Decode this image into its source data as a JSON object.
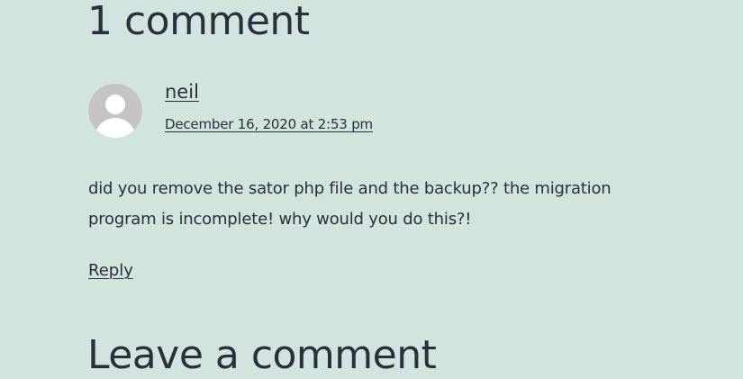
{
  "comments": {
    "title": "1 comment",
    "items": [
      {
        "author": "neil",
        "date": "December 16, 2020 at 2:53 pm",
        "body": "did you remove the sator php file and the backup?? the migration program is incomplete! why would you do this?!",
        "reply_label": "Reply",
        "avatar_icon": "default-user-avatar-icon"
      }
    ]
  },
  "respond": {
    "title": "Leave a comment"
  },
  "colors": {
    "background": "#d1e4dd",
    "text": "#28303d",
    "avatar": "#c4c4c4"
  }
}
